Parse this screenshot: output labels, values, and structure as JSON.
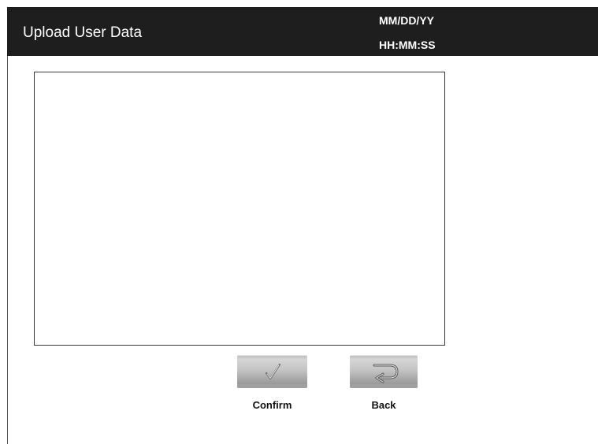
{
  "header": {
    "title": "Upload User Data",
    "date": "MM/DD/YY",
    "time": "HH:MM:SS"
  },
  "actions": {
    "confirm_label": "Confirm",
    "confirm_icon": "checkmark-icon",
    "back_label": "Back",
    "back_icon": "return-arrow-icon"
  },
  "colors": {
    "header_background": "#1e1e1e",
    "header_text": "#ffffff",
    "button_face": "#c4c4c4"
  }
}
